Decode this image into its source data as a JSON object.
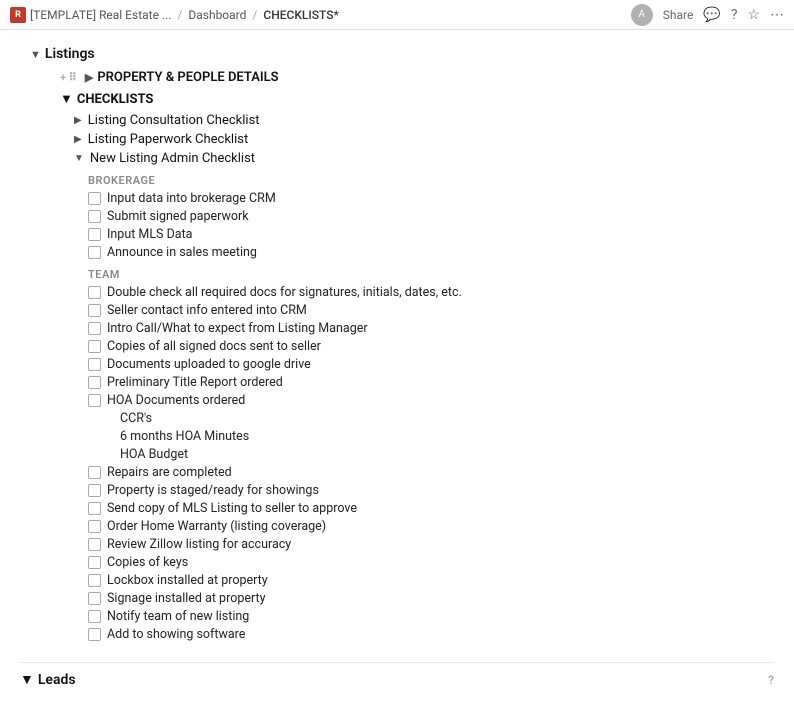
{
  "topbar": {
    "logo_text": "R",
    "breadcrumb": [
      {
        "label": "[TEMPLATE] Real Estate ..."
      },
      {
        "label": "Dashboard"
      },
      {
        "label": "CHECKLISTS*"
      }
    ],
    "share_label": "Share",
    "avatar_initials": "A"
  },
  "listings": {
    "toggle": "▼",
    "label": "Listings",
    "property_section": {
      "toggle": "▶",
      "label": "PROPERTY & PEOPLE DETAILS"
    },
    "checklists": {
      "toggle": "▼",
      "label": "CHECKLISTS",
      "items": [
        {
          "id": "listing-consultation",
          "toggle": "▶",
          "label": "Listing Consultation Checklist",
          "expanded": false
        },
        {
          "id": "listing-paperwork",
          "toggle": "▶",
          "label": "Listing Paperwork Checklist",
          "expanded": false
        },
        {
          "id": "new-listing-admin",
          "toggle": "▼",
          "label": "New Listing Admin Checklist",
          "expanded": true,
          "groups": [
            {
              "id": "brokerage",
              "label": "BROKERAGE",
              "items": [
                {
                  "id": "b1",
                  "text": "Input data into brokerage CRM",
                  "checked": false
                },
                {
                  "id": "b2",
                  "text": "Submit signed paperwork",
                  "checked": false
                },
                {
                  "id": "b3",
                  "text": "Input MLS Data",
                  "checked": false
                },
                {
                  "id": "b4",
                  "text": "Announce in sales meeting",
                  "checked": false
                }
              ]
            },
            {
              "id": "team",
              "label": "TEAM",
              "items": [
                {
                  "id": "t1",
                  "text": "Double check all required docs for signatures, initials, dates, etc.",
                  "checked": false
                },
                {
                  "id": "t2",
                  "text": "Seller contact info entered into CRM",
                  "checked": false
                },
                {
                  "id": "t3",
                  "text": "Intro Call/What to expect from Listing Manager",
                  "checked": false
                },
                {
                  "id": "t4",
                  "text": "Copies of all signed docs sent to seller",
                  "checked": false
                },
                {
                  "id": "t5",
                  "text": "Documents uploaded to google drive",
                  "checked": false
                },
                {
                  "id": "t6",
                  "text": "Preliminary Title Report ordered",
                  "checked": false
                },
                {
                  "id": "t7",
                  "text": "HOA Documents ordered",
                  "checked": false,
                  "subitems": [
                    {
                      "id": "t7a",
                      "text": "CCR's",
                      "checked": false
                    },
                    {
                      "id": "t7b",
                      "text": "6 months HOA Minutes",
                      "checked": false
                    },
                    {
                      "id": "t7c",
                      "text": "HOA Budget",
                      "checked": false
                    }
                  ]
                },
                {
                  "id": "t8",
                  "text": "Repairs are completed",
                  "checked": false
                },
                {
                  "id": "t9",
                  "text": "Property is staged/ready for showings",
                  "checked": false
                },
                {
                  "id": "t10",
                  "text": "Send copy of MLS Listing to seller to approve",
                  "checked": false
                },
                {
                  "id": "t11",
                  "text": "Order Home Warranty (listing coverage)",
                  "checked": false
                },
                {
                  "id": "t12",
                  "text": "Review Zillow listing for accuracy",
                  "checked": false
                },
                {
                  "id": "t13",
                  "text": "Copies of keys",
                  "checked": false
                },
                {
                  "id": "t14",
                  "text": "Lockbox installed at property",
                  "checked": false
                },
                {
                  "id": "t15",
                  "text": "Signage installed at property",
                  "checked": false
                },
                {
                  "id": "t16",
                  "text": "Notify team of new listing",
                  "checked": false
                },
                {
                  "id": "t17",
                  "text": "Add to showing software",
                  "checked": false
                }
              ]
            }
          ]
        }
      ]
    }
  },
  "leads": {
    "toggle": "▼",
    "label": "Leads",
    "question_mark": "?"
  }
}
